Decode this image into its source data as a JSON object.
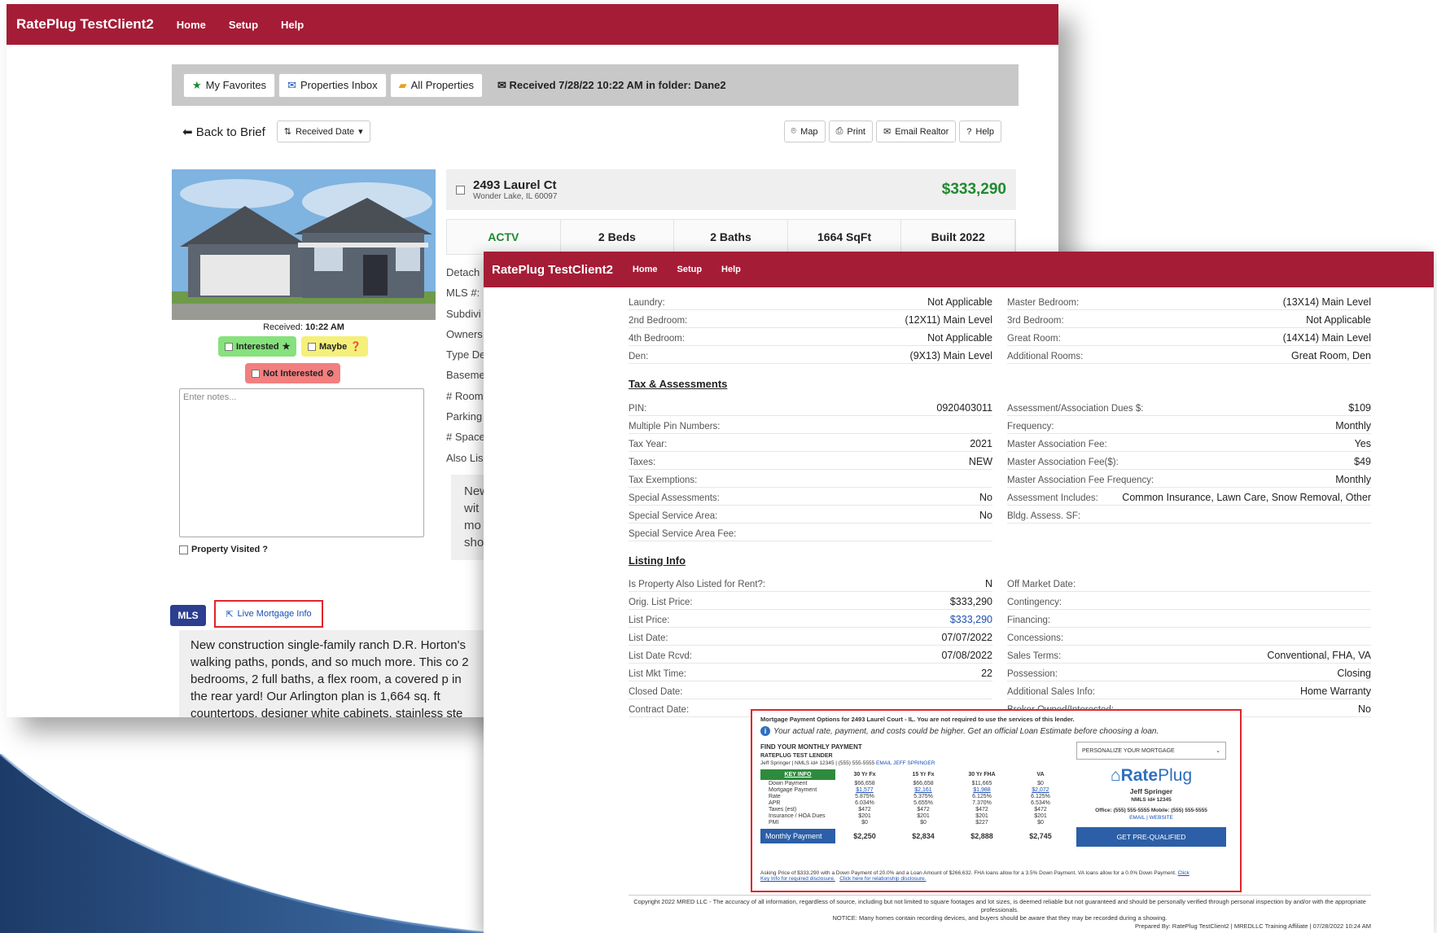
{
  "window1": {
    "brand": "RatePlug TestClient2",
    "nav": [
      "Home",
      "Setup",
      "Help"
    ],
    "tabs": {
      "favorites": "My Favorites",
      "inbox": "Properties Inbox",
      "all": "All Properties"
    },
    "received_info": "Received 7/28/22 10:22 AM in folder: Dane2",
    "back_label": "Back to Brief",
    "sort_label": "Received Date",
    "actions": {
      "map": "Map",
      "print": "Print",
      "email": "Email Realtor",
      "help": "Help"
    },
    "received_label": "Received:",
    "received_time": "10:22 AM",
    "tags": {
      "interested": "Interested",
      "maybe": "Maybe",
      "not_interested": "Not Interested"
    },
    "notes_placeholder": "Enter notes...",
    "visited_label": "Property Visited ?",
    "mls_badge": "MLS",
    "live_mortgage": "Live Mortgage Info",
    "description": "New construction single-family ranch D.R. Horton's walking paths, ponds, and so much more. This co 2 bedrooms, 2 full baths, a flex room, a covered p in the rear yard! Our Arlington plan is 1,664 sq. ft countertops, designer white cabinets, stainless ste",
    "address_line1": "2493 Laurel Ct",
    "address_line2": "Wonder Lake, IL 60097",
    "price": "$333,290",
    "stats": [
      "ACTV",
      "2 Beds",
      "2 Baths",
      "1664 SqFt",
      "Built 2022"
    ],
    "left_labels": [
      "Detach",
      "MLS #:",
      "Subdivi",
      "Owners",
      "Type De",
      "Baseme",
      "# Room",
      "Parking",
      "# Space",
      "Also Lis"
    ],
    "peek_text": "New wit mo sho"
  },
  "window2": {
    "brand": "RatePlug TestClient2",
    "nav": [
      "Home",
      "Setup",
      "Help"
    ],
    "rooms_left": [
      {
        "k": "Laundry:",
        "v": "Not Applicable"
      },
      {
        "k": "2nd Bedroom:",
        "v": "(12X11) Main Level"
      },
      {
        "k": "4th Bedroom:",
        "v": "Not Applicable"
      },
      {
        "k": "Den:",
        "v": "(9X13) Main Level"
      }
    ],
    "rooms_right": [
      {
        "k": "Master Bedroom:",
        "v": "(13X14) Main Level"
      },
      {
        "k": "3rd Bedroom:",
        "v": "Not Applicable"
      },
      {
        "k": "Great Room:",
        "v": "(14X14) Main Level"
      },
      {
        "k": "Additional Rooms:",
        "v": "Great Room, Den"
      }
    ],
    "tax_title": "Tax & Assessments",
    "tax_left": [
      {
        "k": "PIN:",
        "v": "0920403011"
      },
      {
        "k": "Multiple Pin Numbers:",
        "v": ""
      },
      {
        "k": "Tax Year:",
        "v": "2021"
      },
      {
        "k": "Taxes:",
        "v": "NEW"
      },
      {
        "k": "Tax Exemptions:",
        "v": ""
      },
      {
        "k": "Special Assessments:",
        "v": "No"
      },
      {
        "k": "Special Service Area:",
        "v": "No"
      },
      {
        "k": "Special Service Area Fee:",
        "v": ""
      }
    ],
    "tax_right": [
      {
        "k": "Assessment/Association Dues $:",
        "v": "$109"
      },
      {
        "k": "Frequency:",
        "v": "Monthly"
      },
      {
        "k": "Master Association Fee:",
        "v": "Yes"
      },
      {
        "k": "Master Association Fee($):",
        "v": "$49"
      },
      {
        "k": "Master Association Fee Frequency:",
        "v": "Monthly"
      },
      {
        "k": "Assessment Includes:",
        "v": "Common Insurance, Lawn Care, Snow Removal, Other"
      },
      {
        "k": "Bldg. Assess. SF:",
        "v": ""
      }
    ],
    "listing_title": "Listing Info",
    "listing_left": [
      {
        "k": "Is Property Also Listed for Rent?:",
        "v": "N"
      },
      {
        "k": "Orig. List Price:",
        "v": "$333,290"
      },
      {
        "k": "List Price:",
        "v": "$333,290"
      },
      {
        "k": "List Date:",
        "v": "07/07/2022"
      },
      {
        "k": "List Date Rcvd:",
        "v": "07/08/2022"
      },
      {
        "k": "List Mkt Time:",
        "v": "22"
      },
      {
        "k": "Closed Date:",
        "v": ""
      },
      {
        "k": "Contract Date:",
        "v": ""
      }
    ],
    "listing_right": [
      {
        "k": "Off Market Date:",
        "v": ""
      },
      {
        "k": "Contingency:",
        "v": ""
      },
      {
        "k": "Financing:",
        "v": ""
      },
      {
        "k": "Concessions:",
        "v": ""
      },
      {
        "k": "Sales Terms:",
        "v": "Conventional, FHA, VA"
      },
      {
        "k": "Possession:",
        "v": "Closing"
      },
      {
        "k": "Additional Sales Info:",
        "v": "Home Warranty"
      },
      {
        "k": "Broker Owned/Interested:",
        "v": "No"
      }
    ],
    "mortgage": {
      "header": "Mortgage Payment Options for 2493 Laurel Court - IL. You are not required to use the services of this lender.",
      "info": "Your actual rate, payment, and costs could be higher. Get an official Loan Estimate before choosing a loan.",
      "find_title": "FIND YOUR MONTHLY PAYMENT",
      "lender": "RATEPLUG TEST LENDER",
      "lender_info": "Jeff Springer | NMLS id# 12345 | (555) 555-5555",
      "email_link": "EMAIL JEFF SPRINGER",
      "key_info": "KEY INFO",
      "columns": [
        "30 Yr Fx",
        "15 Yr Fx",
        "30 Yr FHA",
        "VA"
      ],
      "rows": [
        {
          "label": "Down Payment",
          "values": [
            "$66,658",
            "$66,658",
            "$11,665",
            "$0"
          ]
        },
        {
          "label": "Mortgage Payment",
          "values": [
            "$1,577",
            "$2,161",
            "$1,988",
            "$2,072"
          ]
        },
        {
          "label": "Rate",
          "values": [
            "5.875%",
            "5.375%",
            "6.125%",
            "6.125%"
          ]
        },
        {
          "label": "APR",
          "values": [
            "6.034%",
            "5.655%",
            "7.370%",
            "6.534%"
          ]
        },
        {
          "label": "Taxes (est)",
          "values": [
            "$472",
            "$472",
            "$472",
            "$472"
          ]
        },
        {
          "label": "Insurance / HOA Dues",
          "values": [
            "$201",
            "$201",
            "$201",
            "$201"
          ]
        },
        {
          "label": "PMI",
          "values": [
            "$0",
            "$0",
            "$227",
            "$0"
          ]
        }
      ],
      "monthly_label": "Monthly Payment",
      "monthly_values": [
        "$2,250",
        "$2,834",
        "$2,888",
        "$2,745"
      ],
      "footnote": "Asking Price of $333,290 with a Down Payment of 20.0% and a Loan Amount of $266,632. FHA loans allow for a 3.5% Down Payment. VA loans allow for a 0.0% Down Payment.",
      "foot_links": [
        "Click",
        "Key Info for required disclosure.",
        "Click here for relationship disclosure."
      ],
      "personalize": "PERSONALIZE YOUR MORTGAGE",
      "logo_a": "Rate",
      "logo_b": "Plug",
      "agent_name": "Jeff Springer",
      "agent_nmls": "NMLS id# 12345",
      "agent_phone": "Office: (555) 555-5555 Mobile: (555) 555-5555",
      "agent_links": "EMAIL | WEBSITE",
      "prequal": "GET PRE-QUALIFIED"
    },
    "copyright": "Copyright 2022 MRED LLC - The accuracy of all information, regardless of source, including but not limited to square footages and lot sizes, is deemed reliable but not guaranteed and should be personally verified through personal inspection by and/or with the appropriate professionals.",
    "notice": "NOTICE: Many homes contain recording devices, and buyers should be aware that they may be recorded during a showing.",
    "prepared": "Prepared By: RatePlug TestClient2 | MREDLLC Training Affiliate | 07/28/2022 10:24 AM"
  },
  "colors": {
    "brand": "#a51c36",
    "price_green": "#1e8a2e",
    "link_blue": "#1a4fb5",
    "highlight_red": "#e0252a"
  }
}
